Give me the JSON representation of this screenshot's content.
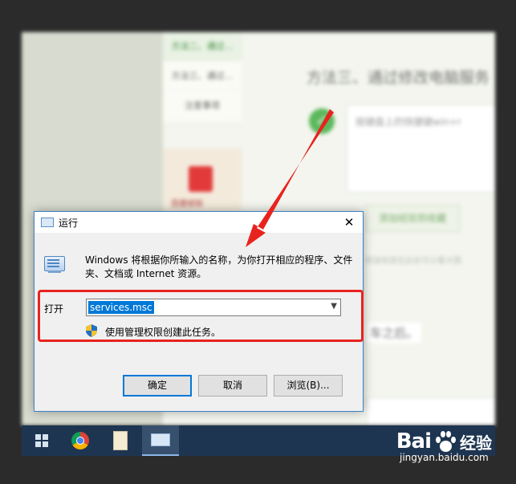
{
  "background": {
    "sidebar": {
      "items": [
        "方法二、通过…",
        "方法三、通过…",
        "注意事项"
      ]
    },
    "promo_caption": "百度经验",
    "title": "方法三、通过修改电脑服务",
    "step_text": "按键盘上的快捷键win+r",
    "action_button": "添加经验到收藏",
    "hint": "将鼠标放在此处可以看大图",
    "after_text": "车之后。"
  },
  "taskbar": {
    "items": [
      "windows-start",
      "chrome",
      "notepad",
      "run-app"
    ]
  },
  "dialog": {
    "title": "运行",
    "close": "✕",
    "description": "Windows 将根据你所输入的名称，为你打开相应的程序、文件夹、文档或 Internet 资源。",
    "open_label": "打开",
    "input_value": "services.msc",
    "admin_text": "使用管理权限创建此任务。",
    "ok": "确定",
    "cancel": "取消",
    "browse": "浏览(B)..."
  },
  "watermark": {
    "brand": "Bai",
    "brand_cn": "经验",
    "url": "jingyan.baidu.com"
  },
  "colors": {
    "highlight": "#e8231e",
    "arrow": "#e8231e",
    "dialog_border": "#3c82c8",
    "selection": "#0078d7"
  }
}
